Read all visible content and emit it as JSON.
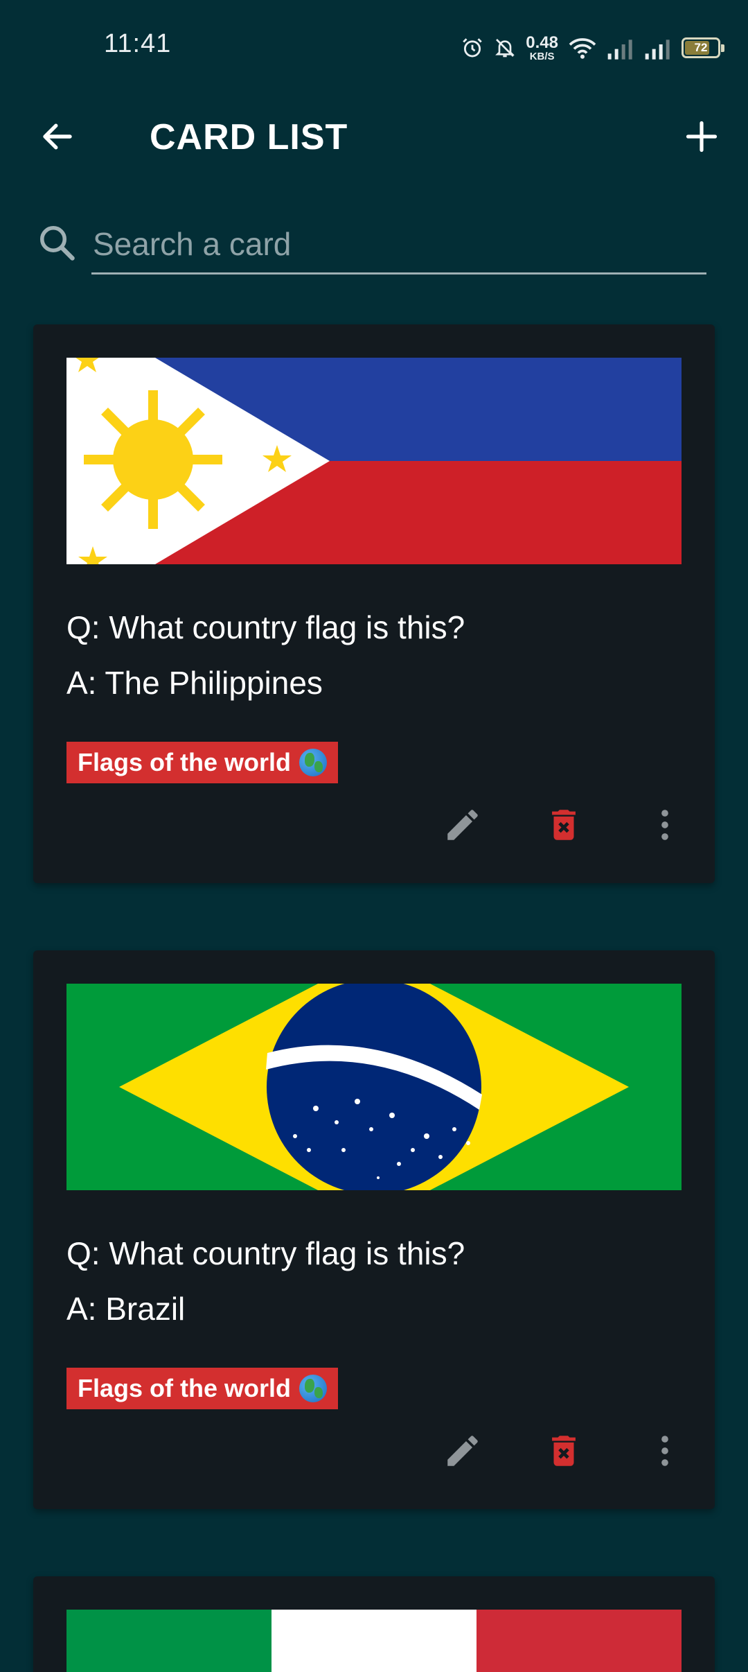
{
  "status_bar": {
    "time": "11:41",
    "net_speed_value": "0.48",
    "net_speed_unit": "KB/S",
    "battery_level": "72"
  },
  "app_bar": {
    "title": "CARD LIST",
    "back_icon": "arrow-left-icon",
    "add_icon": "plus-icon"
  },
  "search": {
    "placeholder": "Search a card",
    "value": ""
  },
  "cards": [
    {
      "flag": "philippines-flag",
      "question": "Q: What country flag is this?",
      "answer": "A: The Philippines",
      "tag": "Flags of the world"
    },
    {
      "flag": "brazil-flag",
      "question": "Q: What country flag is this?",
      "answer": "A: Brazil",
      "tag": "Flags of the world"
    },
    {
      "flag": "italy-flag"
    }
  ],
  "colors": {
    "background": "#032e36",
    "card": "#131a1f",
    "tag": "#d32f2f",
    "delete_icon": "#d32f2f"
  }
}
